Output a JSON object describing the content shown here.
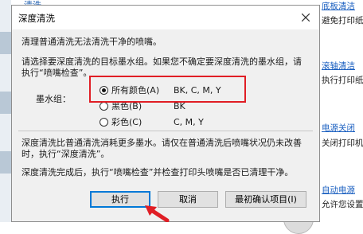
{
  "background": {
    "top_left_text": "清洗",
    "right_panel": [
      {
        "link": "底板清洁",
        "desc": "避免打印纸"
      },
      {
        "link": "滚轴清洁",
        "desc": "执行打印纸"
      },
      {
        "link": "电源关闭",
        "desc": "关闭打印机"
      },
      {
        "link": "自动电源",
        "desc": "允许您设置"
      }
    ]
  },
  "dialog": {
    "title": "深度清洗",
    "intro": "清理普通清洗无法清洗干净的喷嘴。",
    "instruction_line1": "请选择要深度清洗的目标墨水组。如果您不确定要深度清洗的墨水组，请",
    "instruction_line2": "执行“喷嘴检查”。",
    "ink_group_label": "墨水组：",
    "options": [
      {
        "label": "所有颜色(A)",
        "colors": "BK, C, M, Y",
        "checked": true
      },
      {
        "label": "黑色(B)",
        "colors": "BK",
        "checked": false
      },
      {
        "label": "彩色(C)",
        "colors": "C, M, Y",
        "checked": false
      }
    ],
    "note_line1": "深度清洗比普通清洗消耗更多墨水。请仅在普通清洗后喷嘴状况仍未改善",
    "note_line2": "时，执行“深度清洗”。",
    "after_text": "深度清洗完成后，执行“喷嘴检查”并检查打印头喷嘴是否已清理干净。",
    "buttons": {
      "execute": "执行",
      "cancel": "取消",
      "confirm_items": "最初确认项目(I)"
    }
  },
  "colors": {
    "highlight": "#e01e25",
    "link": "#1a5fc0",
    "dialog_bg": "#f0f0f0",
    "default_button_border": "#0078d7"
  },
  "icons": {
    "close": "close-icon",
    "annotation_arrow": "arrow-icon"
  }
}
